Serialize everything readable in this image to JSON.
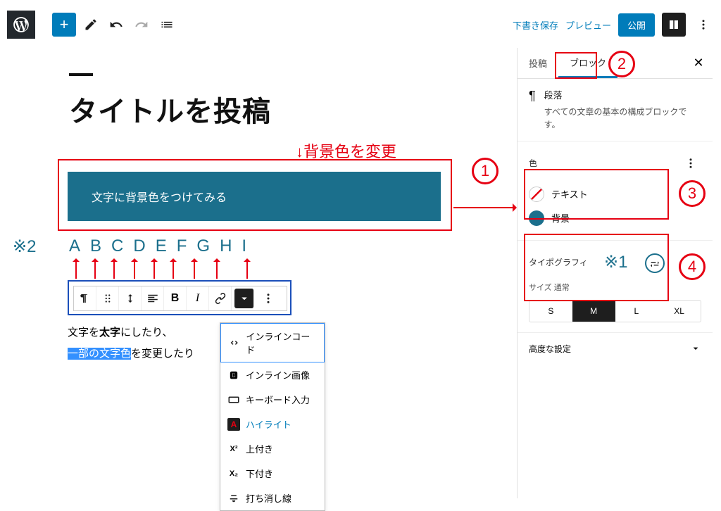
{
  "topbar": {
    "save_draft": "下書き保存",
    "preview": "プレビュー",
    "publish": "公開"
  },
  "editor": {
    "title": "タイトルを投稿",
    "block_bg_text": "文字に背景色をつけてみる",
    "sample_line1_a": "文字を",
    "sample_line1_b": "太字",
    "sample_line1_c": "にしたり、",
    "sample_line2_a": "一部の文字色",
    "sample_line2_b": "を変更したり"
  },
  "letters": [
    "A",
    "B",
    "C",
    "D",
    "E",
    "F",
    "G",
    "H",
    "I"
  ],
  "dropdown": {
    "inline_code": "インラインコード",
    "inline_image": "インライン画像",
    "keyboard": "キーボード入力",
    "highlight": "ハイライト",
    "superscript": "上付き",
    "subscript": "下付き",
    "strikethrough": "打ち消し線"
  },
  "sidebar": {
    "tab_post": "投稿",
    "tab_block": "ブロック",
    "block_name": "段落",
    "block_desc": "すべての文章の基本の構成ブロックです。",
    "color_title": "色",
    "color_text": "テキスト",
    "color_bg": "背景",
    "typo_title": "タイポグラフィ",
    "size_label": "サイズ",
    "size_default": "通常",
    "sizes": [
      "S",
      "M",
      "L",
      "XL"
    ],
    "advanced": "高度な設定"
  },
  "annotations": {
    "bg_change": "↓背景色を変更",
    "asterisk2": "※2",
    "asterisk1": "※1",
    "n1": "1",
    "n2": "2",
    "n3": "3",
    "n4": "4"
  }
}
